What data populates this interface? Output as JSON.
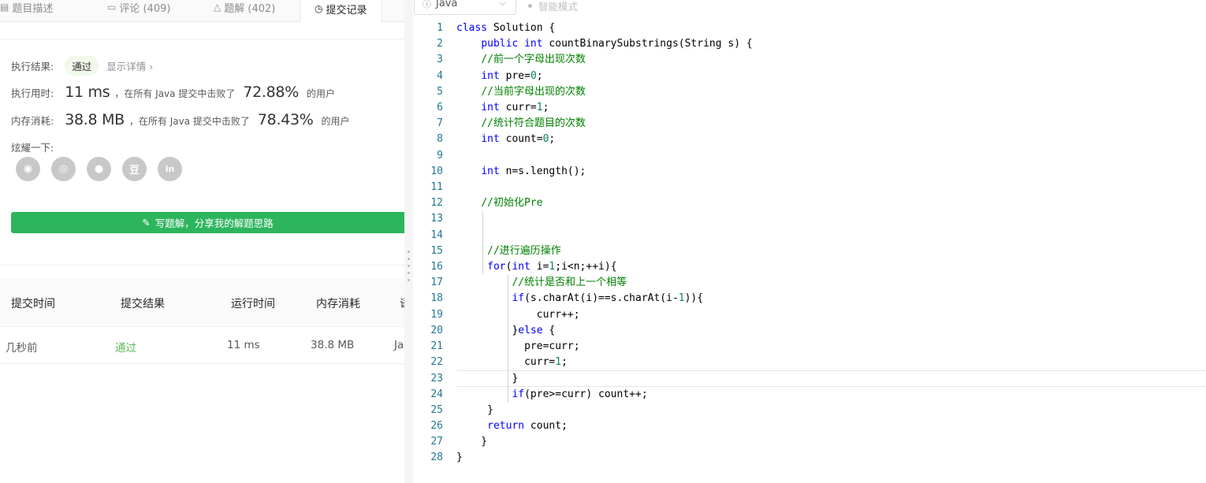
{
  "tabs": [
    {
      "label": "题目描述",
      "icon": "document-icon"
    },
    {
      "label": "评论 (409)",
      "icon": "comment-icon"
    },
    {
      "label": "题解 (402)",
      "icon": "solution-icon"
    },
    {
      "label": "提交记录",
      "icon": "clock-icon"
    }
  ],
  "result": {
    "status_label": "执行结果:",
    "status_value": "通过",
    "detail_link": "显示详情 ›",
    "time_label": "执行用时:",
    "time_value": "11 ms",
    "time_desc": "，在所有 Java 提交中击败了",
    "time_pct": "72.88%",
    "time_users": "的用户",
    "mem_label": "内存消耗:",
    "mem_value": "38.8 MB",
    "mem_desc": "，在所有 Java 提交中击败了",
    "mem_pct": "78.43%",
    "mem_users": "的用户",
    "share_label": "炫耀一下:"
  },
  "share_icons": [
    "wechat-icon",
    "weibo-icon",
    "qq-icon",
    "douban-icon",
    "linkedin-icon"
  ],
  "share_glyphs": [
    "◉",
    "◎",
    "●",
    "豆",
    "in"
  ],
  "write_button": "写题解，分享我的解题思路",
  "table": {
    "headers": [
      "提交时间",
      "提交结果",
      "运行时间",
      "内存消耗",
      "语"
    ],
    "rows": [
      {
        "time": "几秒前",
        "result": "通过",
        "runtime": "11 ms",
        "memory": "38.8 MB",
        "lang": "Ja"
      }
    ]
  },
  "editor": {
    "language": "Java",
    "smart_mode": "智能模式",
    "current_line": 23,
    "lines": [
      "class Solution {",
      "    public int countBinarySubstrings(String s) {",
      "    //前一个字母出现次数",
      "    int pre=0;",
      "    //当前字母出现的次数",
      "    int curr=1;",
      "    //统计符合题目的次数",
      "    int count=0;",
      "",
      "    int n=s.length();",
      "",
      "    //初始化Pre",
      "",
      "",
      "     //进行遍历操作",
      "     for(int i=1;i<n;++i){",
      "         //统计是否和上一个相等",
      "         if(s.charAt(i)==s.charAt(i-1)){",
      "             curr++;",
      "         }else {",
      "           pre=curr;",
      "           curr=1;",
      "         }",
      "         if(pre>=curr) count++;",
      "     }",
      "     return count;",
      "    }",
      "}"
    ]
  },
  "colors": {
    "accent_green": "#2db55d",
    "pass_green": "#5cb85c",
    "keyword": "#0000ff",
    "comment": "#008000",
    "number": "#098658",
    "line_number": "#237893"
  }
}
